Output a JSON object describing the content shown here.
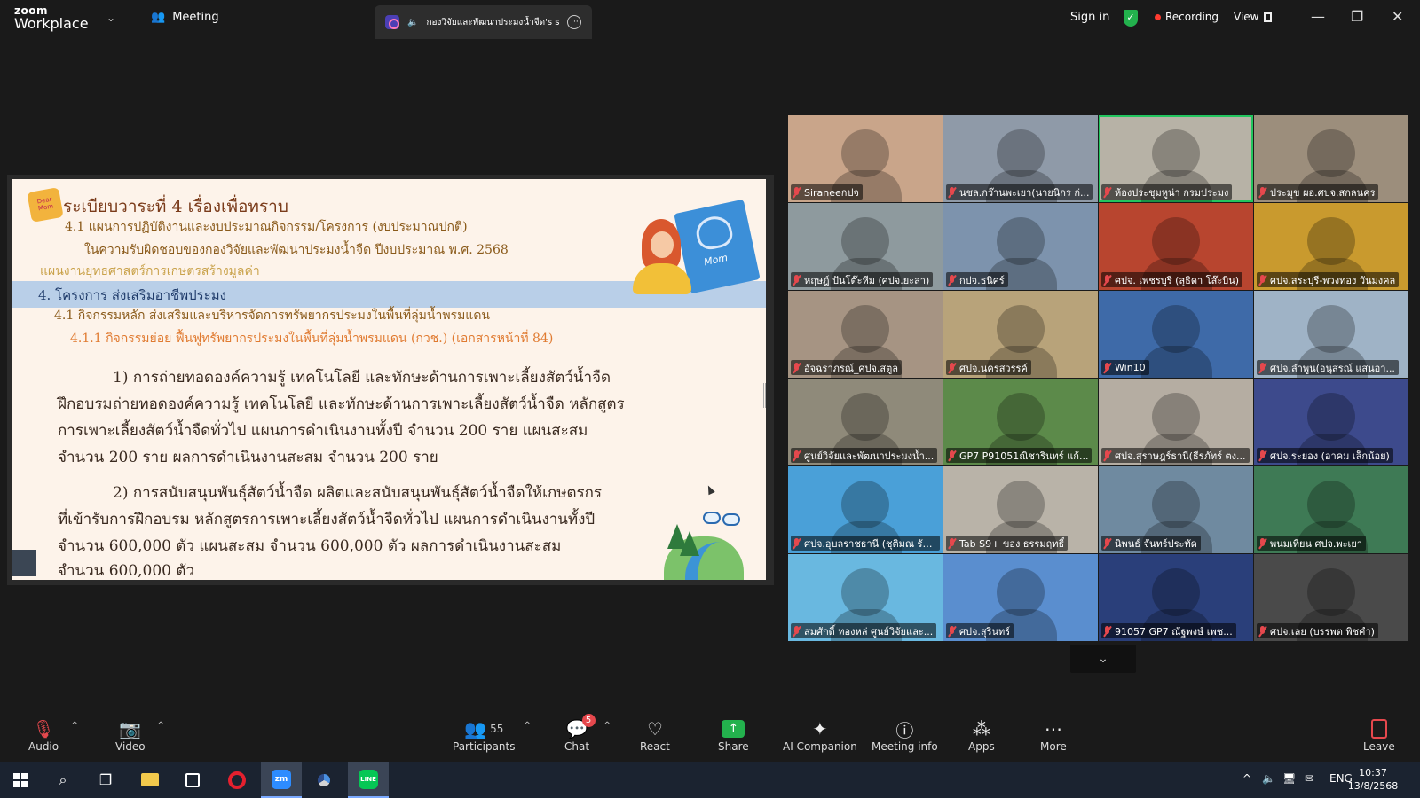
{
  "topbar": {
    "logo_line1": "zoom",
    "logo_line2": "Workplace",
    "meeting_label": "Meeting",
    "tab_title": "กองวิจัยและพัฒนาประมงน้ำจืด's s",
    "signin_label": "Sign in",
    "recording_label": "Recording",
    "view_label": "View"
  },
  "slide": {
    "sticker_text": "Dear Mom",
    "title": "ระเบียบวาระที่ 4 เรื่องเพื่อทราบ",
    "item_4_1": "4.1 แผนการปฏิบัติงานและงบประมาณกิจกรรม/โครงการ (งบประมาณปกติ)",
    "item_4_1_scope": "ในความรับผิดชอบของกองวิจัยและพัฒนาประมงน้ำจืด ปีงบประมาณ พ.ศ. 2568",
    "plan": "แผนงานยุทธศาสตร์การเกษตรสร้างมูลค่า",
    "project": "4. โครงการ ส่งเสริมอาชีพประมง",
    "activity": "4.1 กิจกรรมหลัก ส่งเสริมและบริหารจัดการทรัพยากรประมงในพื้นที่ลุ่มน้ำพรมแดน",
    "subactivity": "4.1.1 กิจกรรมย่อย ฟื้นฟูทรัพยากรประมงในพื้นที่ลุ่มน้ำพรมแดน (กวช.) (เอกสารหน้าที่ 84)",
    "p1_l1": "1) การถ่ายทอดองค์ความรู้ เทคโนโลยี และทักษะด้านการเพาะเลี้ยงสัตว์น้ำจืด",
    "p1_l2": "ฝึกอบรมถ่ายทอดองค์ความรู้ เทคโนโลยี และทักษะด้านการเพาะเลี้ยงสัตว์น้ำจืด หลักสูตร",
    "p1_l3": "การเพาะเลี้ยงสัตว์น้ำจืดทั่วไป แผนการดำเนินงานทั้งปี จำนวน 200 ราย แผนสะสม",
    "p1_l4": "จำนวน 200 ราย ผลการดำเนินงานสะสม จำนวน 200 ราย",
    "p2_l1": "2) การสนับสนุนพันธุ์สัตว์น้ำจืด ผลิตและสนับสนุนพันธุ์สัตว์น้ำจืดให้เกษตรกร",
    "p2_l2": "ที่เข้ารับการฝึกอบรม หลักสูตรการเพาะเลี้ยงสัตว์น้ำจืดทั่วไป แผนการดำเนินงานทั้งปี",
    "p2_l3": "จำนวน 600,000 ตัว แผนสะสม จำนวน 600,000 ตัว ผลการดำเนินงานสะสม",
    "p2_l4": "จำนวน 600,000 ตัว",
    "mom_text": "Mom"
  },
  "participants": [
    {
      "name": "Siraneeกปจ",
      "bg": "#c9a58a"
    },
    {
      "name": "นชล.กว๊านพะเยา(นายนิกร ก่...",
      "bg": "#8f9aa8"
    },
    {
      "name": "ห้องประชุมหูน่า กรมประมง",
      "bg": "#b7b2a6",
      "active": true
    },
    {
      "name": "ประมุข ผอ.ศปจ.สกลนคร",
      "bg": "#9c8e7c"
    },
    {
      "name": "หฤษฎ์ ปันโต๊ะหีม (ศปจ.ยะลา)",
      "bg": "#8e9a9e"
    },
    {
      "name": "กปจ.ธนิศร์",
      "bg": "#7d93ad"
    },
    {
      "name": "ศปจ. เพชรบุรี (สุธิดา โส๊ะบิน)",
      "bg": "#b8452f"
    },
    {
      "name": "ศปจ.สระบุรี-พวงทอง วันมงคล",
      "bg": "#c99a2e"
    },
    {
      "name": "อัจฉราภรณ์_ศปจ.สตูล",
      "bg": "#a69483"
    },
    {
      "name": "ศปจ.นครสวรรค์",
      "bg": "#b8a37a"
    },
    {
      "name": "Win10",
      "bg": "#3e6aa8"
    },
    {
      "name": "ศปจ.ลำพูน(อนุสรณ์ แสนอา...",
      "bg": "#9fb3c6"
    },
    {
      "name": "ศูนย์วิจัยและพัฒนาประมงน้ำ...",
      "bg": "#8f8a7a"
    },
    {
      "name": "GP7 P91051ณิชารินทร์ แก้...",
      "bg": "#5c8a4a"
    },
    {
      "name": "ศปจ.สุราษฎร์ธานี(ธีรภัทร์ ตง...",
      "bg": "#b5ada2"
    },
    {
      "name": "ศปจ.ระยอง (อาคม เล็กน้อย)",
      "bg": "#3d4a8c"
    },
    {
      "name": "ศปจ.อุบลราชธานี (ชุติมณ รัต...",
      "bg": "#4aa0d8"
    },
    {
      "name": "Tab S9+ ของ ธรรมฤทธิ์",
      "bg": "#b9b3a8"
    },
    {
      "name": "นิพนธ์ จันทร์ประทัด",
      "bg": "#6f8aa0"
    },
    {
      "name": "พนมเทียน ศปจ.พะเยา",
      "bg": "#3e7a55"
    },
    {
      "name": "สมศักดิ์ ทองหล่ ศูนย์วิจัยและ...",
      "bg": "#69b8e0"
    },
    {
      "name": "ศปจ.สุรินทร์",
      "bg": "#5a8ecf"
    },
    {
      "name": "91057 GP7 ณัฐพงษ์ เพช...",
      "bg": "#2a3f7a"
    },
    {
      "name": "ศปจ.เลย (บรรพต พิชคำ)",
      "bg": "#4a4a4a"
    }
  ],
  "toolbar": {
    "audio": "Audio",
    "video": "Video",
    "participants": "Participants",
    "participants_count": "55",
    "chat": "Chat",
    "chat_badge": "5",
    "react": "React",
    "share": "Share",
    "ai": "AI Companion",
    "info": "Meeting info",
    "apps": "Apps",
    "more": "More",
    "leave": "Leave"
  },
  "taskbar": {
    "zm_label": "zm",
    "line_label": "LINE",
    "lang": "ENG",
    "time": "10:37",
    "date": "13/8/2568"
  },
  "colors": {
    "active_speaker": "#22c55e",
    "muted_red": "#e5484d",
    "share_green": "#23b14d"
  }
}
